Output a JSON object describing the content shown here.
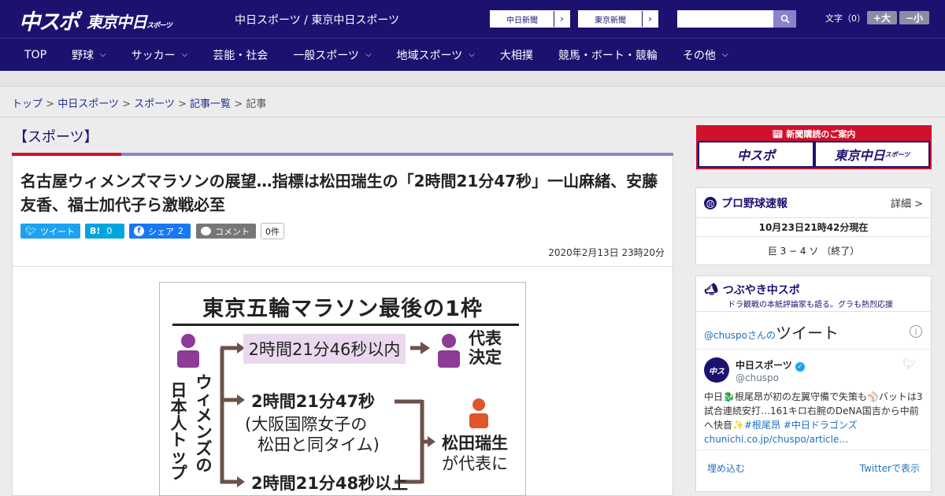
{
  "header": {
    "logo_chuspo": "中スポ",
    "logo_tokyo": "東京中日",
    "logo_tokyo_small": "スポーツ",
    "site_name": "中日スポーツ / 東京中日スポーツ",
    "ext_links": [
      "中日新聞",
      "東京新聞"
    ],
    "font_size_label": "文字（0）",
    "font_bigger": "+大",
    "font_smaller": "−小"
  },
  "nav": {
    "items": [
      {
        "label": "TOP",
        "has_menu": false
      },
      {
        "label": "野球",
        "has_menu": true
      },
      {
        "label": "サッカー",
        "has_menu": true
      },
      {
        "label": "芸能・社会",
        "has_menu": false
      },
      {
        "label": "一般スポーツ",
        "has_menu": true
      },
      {
        "label": "地域スポーツ",
        "has_menu": true
      },
      {
        "label": "大相撲",
        "has_menu": false
      },
      {
        "label": "競馬・ボート・競輪",
        "has_menu": false
      },
      {
        "label": "その他",
        "has_menu": true
      }
    ]
  },
  "breadcrumb": [
    "トップ",
    "中日スポーツ",
    "スポーツ",
    "記事一覧",
    "記事"
  ],
  "section_title": "【スポーツ】",
  "article": {
    "headline": "名古屋ウィメンズマラソンの展望…指標は松田瑞生の「2時間21分47秒」一山麻緒、安藤友香、福士加代子ら激戦必至",
    "share": {
      "tweet": "ツイート",
      "hatena": "B!",
      "hatena_count": "0",
      "facebook": "シェア",
      "facebook_count": "2",
      "comment": "コメント",
      "comment_count": "0件"
    },
    "date": "2020年2月13日 23時20分"
  },
  "figure": {
    "title": "東京五輪マラソン最後の1枠",
    "left_vertical": [
      "ウィメンズの",
      "日本人トップ"
    ],
    "row1": "2時間21分46秒以内",
    "row1_result": [
      "代表",
      "決定"
    ],
    "row2": "2時間21分47秒",
    "row2_note": [
      "(大阪国際女子の",
      "松田と同タイム)"
    ],
    "row3": "2時間21分48秒以上",
    "result2": [
      "松田瑞生",
      "が代表に"
    ],
    "accent_purple": "#8e3a97",
    "accent_orange": "#e0562b",
    "arrow_brown": "#6b5248"
  },
  "sidebar": {
    "ad_head": "新聞購読のご案内",
    "ad_cells": [
      "中スポ",
      "東京中日"
    ],
    "ad_cell_small": "スポーツ",
    "baseball": {
      "title": "プロ野球速報",
      "detail": "詳細 >",
      "updated": "10月23日21時42分現在",
      "score": "巨 3 − 4 ソ （終了）"
    },
    "tsubuyaki": {
      "title": "つぶやき中スポ",
      "subtitle": "ドラ観戦の本紙評論家も語る。グラも熱烈応援",
      "tweets_by": "@chuspoさんの",
      "tweets_label": "ツイート",
      "account_name": "中日スポーツ",
      "account_handle": "@chuspo",
      "tweet_text": "中日🐉根尾昂が初の左翼守備で失策も⚾バットは3試合連続安打…161キロ右腕のDeNA国吉から中前へ快音✨",
      "tweet_tags": "#根尾昂 #中日ドラゴンズ",
      "tweet_link": "chunichi.co.jp/chuspo/article…",
      "embed": "埋め込む",
      "view_on_twitter": "Twitterで表示"
    }
  },
  "colors": {
    "brand_navy": "#1b1270",
    "brand_red": "#d0112b",
    "link_blue": "#1f2f8f",
    "twitter": "#1da1f2",
    "hatena": "#00a4de",
    "facebook": "#1877f2",
    "comment_gray": "#777777"
  }
}
